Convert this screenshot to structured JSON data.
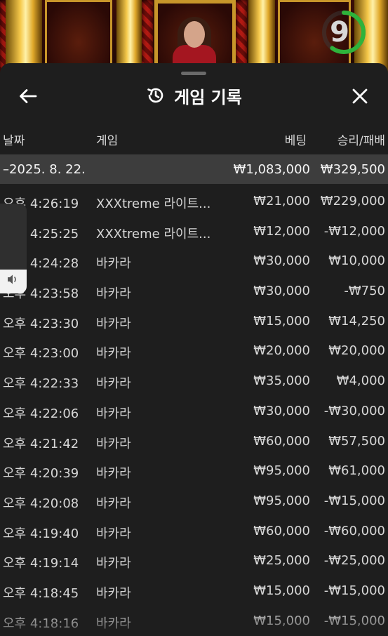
{
  "timer": {
    "value": "9",
    "progress": 0.6,
    "color": "#2eb33b"
  },
  "header": {
    "title": "게임 기록",
    "back_icon": "arrow-left-icon",
    "history_icon": "history-clock-icon",
    "close_icon": "close-icon"
  },
  "columns": {
    "date": "날짜",
    "game": "게임",
    "bet": "베팅",
    "result": "승리/패배"
  },
  "summary": {
    "date": "–2025. 8. 22.",
    "bet": "₩1,083,000",
    "result": "₩329,500"
  },
  "rows": [
    {
      "time": "오후 4:26:19",
      "game": "XXXtreme 라이트...",
      "bet": "₩21,000",
      "result": "₩229,000"
    },
    {
      "time": "오후 4:25:25",
      "game": "XXXtreme 라이트...",
      "bet": "₩12,000",
      "result": "-₩12,000"
    },
    {
      "time": "오후 4:24:28",
      "game": "바카라",
      "bet": "₩30,000",
      "result": "₩10,000"
    },
    {
      "time": "오후 4:23:58",
      "game": "바카라",
      "bet": "₩30,000",
      "result": "-₩750"
    },
    {
      "time": "오후 4:23:30",
      "game": "바카라",
      "bet": "₩15,000",
      "result": "₩14,250"
    },
    {
      "time": "오후 4:23:00",
      "game": "바카라",
      "bet": "₩20,000",
      "result": "₩20,000"
    },
    {
      "time": "오후 4:22:33",
      "game": "바카라",
      "bet": "₩35,000",
      "result": "₩4,000"
    },
    {
      "time": "오후 4:22:06",
      "game": "바카라",
      "bet": "₩30,000",
      "result": "-₩30,000"
    },
    {
      "time": "오후 4:21:42",
      "game": "바카라",
      "bet": "₩60,000",
      "result": "₩57,500"
    },
    {
      "time": "오후 4:20:39",
      "game": "바카라",
      "bet": "₩95,000",
      "result": "₩61,000"
    },
    {
      "time": "오후 4:20:08",
      "game": "바카라",
      "bet": "₩95,000",
      "result": "-₩15,000"
    },
    {
      "time": "오후 4:19:40",
      "game": "바카라",
      "bet": "₩60,000",
      "result": "-₩60,000"
    },
    {
      "time": "오후 4:19:14",
      "game": "바카라",
      "bet": "₩25,000",
      "result": "-₩25,000"
    },
    {
      "time": "오후 4:18:45",
      "game": "바카라",
      "bet": "₩15,000",
      "result": "-₩15,000"
    },
    {
      "time": "오후 4:18:16",
      "game": "바카라",
      "bet": "₩15,000",
      "result": "-₩15,000"
    }
  ],
  "side_widget": {
    "icon": "speaker-icon"
  }
}
